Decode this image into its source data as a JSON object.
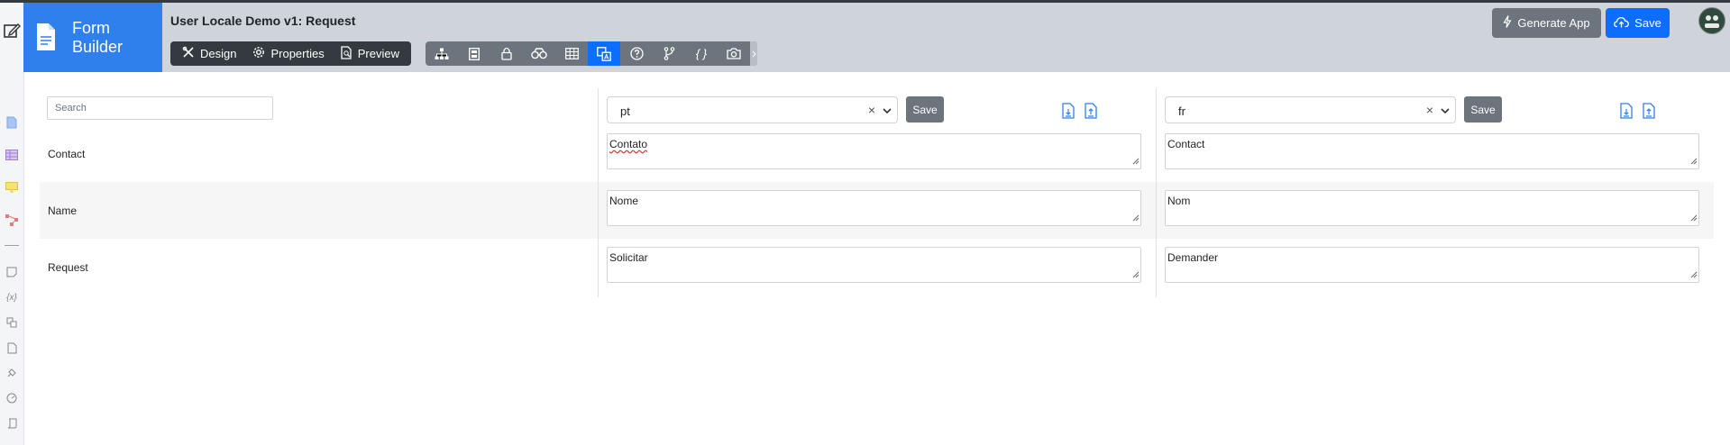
{
  "app": {
    "brand_line1": "Form",
    "brand_line2": "Builder",
    "title": "User Locale Demo v1: Request"
  },
  "tabs": [
    {
      "label": "Design",
      "icon": "design-tools-icon"
    },
    {
      "label": "Properties",
      "icon": "gear-icon"
    },
    {
      "label": "Preview",
      "icon": "preview-icon"
    }
  ],
  "toolbar": [
    "sitemap-icon",
    "form-icon",
    "lock-icon",
    "binoculars-icon",
    "table-icon",
    "translate-icon",
    "help-icon",
    "branch-icon",
    "code-braces-icon",
    "camera-icon"
  ],
  "actions": {
    "generate_app": "Generate App",
    "save": "Save"
  },
  "search": {
    "placeholder": "Search",
    "value": ""
  },
  "locales": [
    {
      "code": "pt",
      "save_label": "Save",
      "translations": [
        "Contato",
        "Nome",
        "Solicitar"
      ]
    },
    {
      "code": "fr",
      "save_label": "Save",
      "translations": [
        "Contact",
        "Nom",
        "Demander"
      ]
    }
  ],
  "rows": [
    "Contact",
    "Name",
    "Request"
  ],
  "colors": {
    "brand": "#2f80ed",
    "header": "#ced4da",
    "dark": "#343a40",
    "primary": "#0d6efd",
    "secondary": "#6c757d"
  }
}
